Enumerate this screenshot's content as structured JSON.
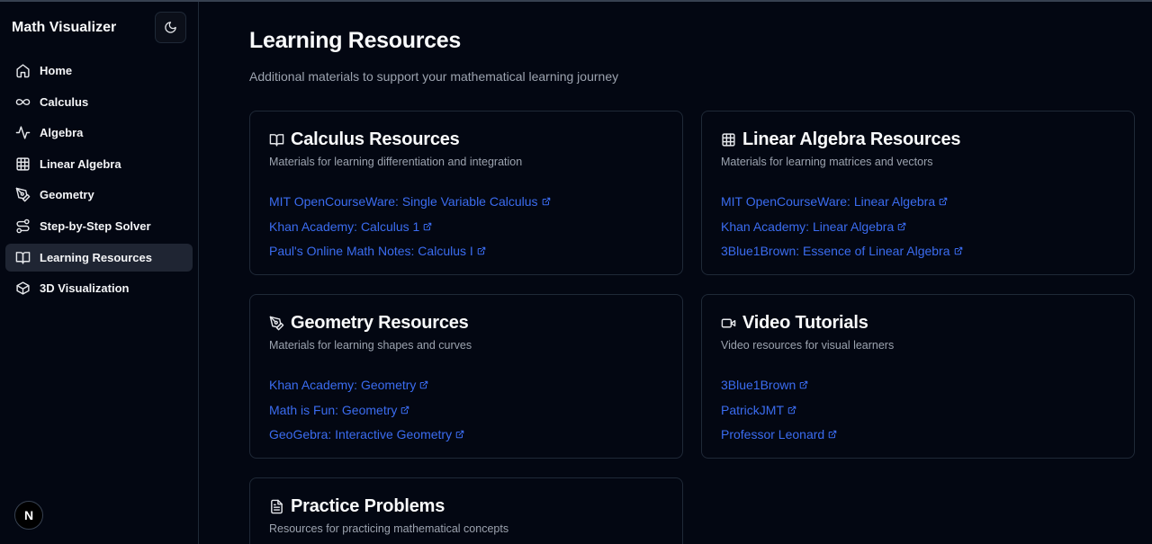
{
  "app": {
    "title": "Math Visualizer"
  },
  "sidebar": {
    "items": [
      {
        "label": "Home",
        "icon": "home-icon",
        "active": false
      },
      {
        "label": "Calculus",
        "icon": "infinity-icon",
        "active": false
      },
      {
        "label": "Algebra",
        "icon": "activity-icon",
        "active": false
      },
      {
        "label": "Linear Algebra",
        "icon": "grid-icon",
        "active": false
      },
      {
        "label": "Geometry",
        "icon": "pen-tool-icon",
        "active": false
      },
      {
        "label": "Step-by-Step Solver",
        "icon": "route-icon",
        "active": false
      },
      {
        "label": "Learning Resources",
        "icon": "book-open-icon",
        "active": true
      },
      {
        "label": "3D Visualization",
        "icon": "box-icon",
        "active": false
      }
    ],
    "badge": "N"
  },
  "page": {
    "title": "Learning Resources",
    "subtitle": "Additional materials to support your mathematical learning journey"
  },
  "cards": [
    {
      "title": "Calculus Resources",
      "icon": "book-open-icon",
      "description": "Materials for learning differentiation and integration",
      "links": [
        "MIT OpenCourseWare: Single Variable Calculus",
        "Khan Academy: Calculus 1",
        "Paul's Online Math Notes: Calculus I"
      ]
    },
    {
      "title": "Linear Algebra Resources",
      "icon": "grid-icon",
      "description": "Materials for learning matrices and vectors",
      "links": [
        "MIT OpenCourseWare: Linear Algebra",
        "Khan Academy: Linear Algebra",
        "3Blue1Brown: Essence of Linear Algebra"
      ]
    },
    {
      "title": "Geometry Resources",
      "icon": "pen-tool-icon",
      "description": "Materials for learning shapes and curves",
      "links": [
        "Khan Academy: Geometry",
        "Math is Fun: Geometry",
        "GeoGebra: Interactive Geometry"
      ]
    },
    {
      "title": "Video Tutorials",
      "icon": "video-icon",
      "description": "Video resources for visual learners",
      "links": [
        "3Blue1Brown",
        "PatrickJMT",
        "Professor Leonard"
      ]
    },
    {
      "title": "Practice Problems",
      "icon": "file-text-icon",
      "description": "Resources for practicing mathematical concepts",
      "links": []
    }
  ],
  "colors": {
    "background": "#030712",
    "link": "#3b6cf0",
    "muted": "#9ca3af",
    "active_nav": "#1f2533"
  }
}
